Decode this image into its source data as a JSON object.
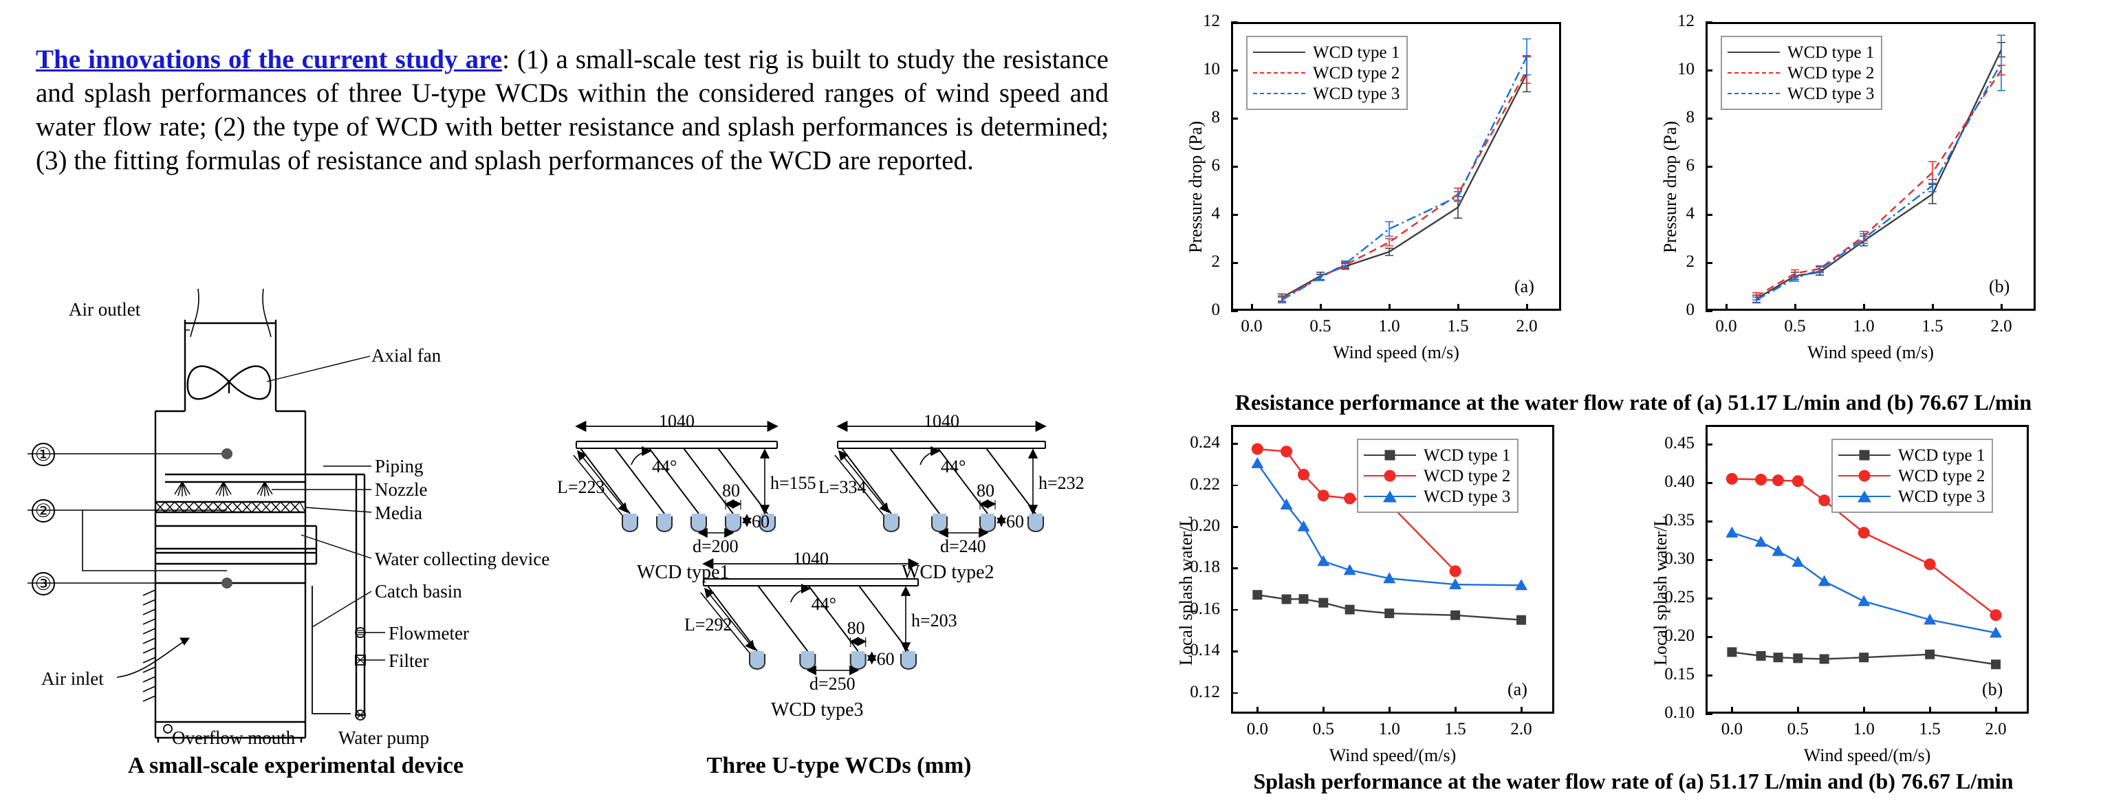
{
  "intro": {
    "lead": "The innovations of the current study are",
    "body": ": (1) a small-scale test rig is built to study the resistance and splash performances of three U-type WCDs within the considered ranges of wind speed and water flow rate; (2) the type of WCD with better resistance and splash performances is determined; (3) the fitting formulas of resistance and splash performances of the WCD are reported.",
    "lead_color": "#1919d0"
  },
  "captions": {
    "device": "A small-scale experimental device",
    "wcds": "Three U-type WCDs (mm)",
    "resistance": "Resistance performance  at the water flow rate of (a) 51.17 L/min and (b) 76.67 L/min",
    "splash": "Splash performance  at the water flow rate of (a) 51.17 L/min and (b) 76.67 L/min"
  },
  "device_diagram": {
    "labels": {
      "air_outlet": "Air outlet",
      "axial_fan": "Axial fan",
      "piping": "Piping",
      "nozzle": "Nozzle",
      "media": "Media",
      "water_collecting_device": "Water collecting device",
      "catch_basin": "Catch basin",
      "flowmeter": "Flowmeter",
      "filter": "Filter",
      "air_inlet": "Air inlet",
      "overflow_mouth": "Overflow mouth",
      "water_pump": "Water pump"
    },
    "callouts": [
      "①",
      "②",
      "③"
    ]
  },
  "wcds": [
    {
      "name": "WCD type1",
      "span": "1040",
      "L": "L=223",
      "angle": "44°",
      "width80": "80",
      "depth60": "60",
      "h": "h=155",
      "d": "d=200",
      "cups": 5
    },
    {
      "name": "WCD type2",
      "span": "1040",
      "L": "L=334",
      "angle": "44°",
      "width80": "80",
      "depth60": "60",
      "h": "h=232",
      "d": "d=240",
      "cups": 4
    },
    {
      "name": "WCD type3",
      "span": "1040",
      "L": "L=292",
      "angle": "44°",
      "width80": "80",
      "depth60": "60",
      "h": "h=203",
      "d": "d=250",
      "cups": 4
    }
  ],
  "colors": {
    "type1": "#3f3f3f",
    "type2": "#ef2a24",
    "type3": "#1a6fe0"
  },
  "chart_data": [
    {
      "id": "resistance-a",
      "type": "line",
      "title": "",
      "panel_tag": "(a)",
      "xlabel": "Wind speed (m/s)",
      "ylabel": "Pressure drop (Pa)",
      "xlim": [
        -0.15,
        2.25
      ],
      "ylim": [
        0,
        12
      ],
      "xticks": [
        0.0,
        0.5,
        1.0,
        1.5,
        2.0
      ],
      "xticklabels": [
        "0.0",
        "0.5",
        "1.0",
        "1.5",
        "2.0"
      ],
      "yticks": [
        0,
        2,
        4,
        6,
        8,
        10,
        12
      ],
      "yticklabels": [
        "0",
        "2",
        "4",
        "6",
        "8",
        "10",
        "12"
      ],
      "grid": false,
      "legend_position": "top-left",
      "x": [
        0.22,
        0.5,
        0.68,
        1.0,
        1.5,
        2.0
      ],
      "series": [
        {
          "name": "WCD type 1",
          "style": "solid",
          "color": "#3f3f3f",
          "values": [
            0.55,
            1.45,
            1.85,
            2.45,
            4.3,
            9.85
          ],
          "err": [
            0.15,
            0.15,
            0.12,
            0.15,
            0.45,
            0.75
          ]
        },
        {
          "name": "WCD type 2",
          "style": "dashed",
          "color": "#ef2a24",
          "values": [
            0.5,
            1.4,
            1.9,
            2.85,
            4.85,
            10.0
          ],
          "err": [
            0.12,
            0.12,
            0.12,
            0.15,
            0.25,
            0.55
          ]
        },
        {
          "name": "WCD type 3",
          "style": "dashdot",
          "color": "#1a6fe0",
          "values": [
            0.45,
            1.38,
            1.95,
            3.4,
            4.75,
            10.55
          ],
          "err": [
            0.12,
            0.12,
            0.12,
            0.3,
            0.2,
            0.75
          ]
        }
      ]
    },
    {
      "id": "resistance-b",
      "type": "line",
      "title": "",
      "panel_tag": "(b)",
      "xlabel": "Wind speed (m/s)",
      "ylabel": "Pressure drop (Pa)",
      "xlim": [
        -0.15,
        2.25
      ],
      "ylim": [
        0,
        12
      ],
      "xticks": [
        0.0,
        0.5,
        1.0,
        1.5,
        2.0
      ],
      "xticklabels": [
        "0.0",
        "0.5",
        "1.0",
        "1.5",
        "2.0"
      ],
      "yticks": [
        0,
        2,
        4,
        6,
        8,
        10,
        12
      ],
      "yticklabels": [
        "0",
        "2",
        "4",
        "6",
        "8",
        "10",
        "12"
      ],
      "grid": false,
      "legend_position": "top-left",
      "x": [
        0.22,
        0.5,
        0.68,
        1.0,
        1.5,
        2.0
      ],
      "series": [
        {
          "name": "WCD type 1",
          "style": "solid",
          "color": "#3f3f3f",
          "values": [
            0.5,
            1.45,
            1.6,
            2.9,
            4.85,
            10.85
          ],
          "err": [
            0.15,
            0.15,
            0.12,
            0.2,
            0.4,
            0.3
          ]
        },
        {
          "name": "WCD type 2",
          "style": "dashed",
          "color": "#ef2a24",
          "values": [
            0.6,
            1.55,
            1.75,
            3.1,
            5.75,
            10.0
          ],
          "err": [
            0.15,
            0.15,
            0.12,
            0.2,
            0.45,
            0.2
          ]
        },
        {
          "name": "WCD type 3",
          "style": "dashdot",
          "color": "#1a6fe0",
          "values": [
            0.45,
            1.35,
            1.7,
            3.0,
            5.2,
            10.3
          ],
          "err": [
            0.12,
            0.12,
            0.12,
            0.2,
            0.25,
            1.15
          ]
        }
      ]
    },
    {
      "id": "splash-a",
      "type": "line",
      "title": "",
      "panel_tag": "(a)",
      "xlabel": "Wind speed/(m/s)",
      "ylabel": "Local splash water/L",
      "xlim": [
        -0.2,
        2.25
      ],
      "ylim": [
        0.11,
        0.249
      ],
      "xticks": [
        0.0,
        0.5,
        1.0,
        1.5,
        2.0
      ],
      "xticklabels": [
        "0.0",
        "0.5",
        "1.0",
        "1.5",
        "2.0"
      ],
      "yticks": [
        0.12,
        0.14,
        0.16,
        0.18,
        0.2,
        0.22,
        0.24
      ],
      "yticklabels": [
        "0.12",
        "0.14",
        "0.16",
        "0.18",
        "0.20",
        "0.22",
        "0.24"
      ],
      "grid": false,
      "legend_position": "top-right",
      "x": [
        0.0,
        0.22,
        0.35,
        0.5,
        0.7,
        1.0,
        1.5,
        2.0
      ],
      "series": [
        {
          "name": "WCD type 1",
          "marker": "square",
          "color": "#3f3f3f",
          "values": [
            0.1672,
            0.1651,
            0.1652,
            0.1634,
            0.1601,
            0.1583,
            0.1574,
            0.1551
          ]
        },
        {
          "name": "WCD type 2",
          "marker": "circle",
          "color": "#ef2a24",
          "values": [
            0.2374,
            0.2362,
            0.2251,
            0.215,
            0.2136,
            0.211,
            0.1786,
            null
          ]
        },
        {
          "name": "WCD type 3",
          "marker": "triangle",
          "color": "#1a6fe0",
          "values": [
            0.2305,
            0.2106,
            0.2001,
            0.1834,
            0.1791,
            0.1751,
            0.1722,
            0.1718
          ]
        }
      ]
    },
    {
      "id": "splash-b",
      "type": "line",
      "title": "",
      "panel_tag": "(b)",
      "xlabel": "Wind speed/(m/s)",
      "ylabel": "Local splash water/L",
      "xlim": [
        -0.2,
        2.25
      ],
      "ylim": [
        0.1,
        0.475
      ],
      "xticks": [
        0.0,
        0.5,
        1.0,
        1.5,
        2.0
      ],
      "xticklabels": [
        "0.0",
        "0.5",
        "1.0",
        "1.5",
        "2.0"
      ],
      "yticks": [
        0.1,
        0.15,
        0.2,
        0.25,
        0.3,
        0.35,
        0.4,
        0.45
      ],
      "yticklabels": [
        "0.10",
        "0.15",
        "0.20",
        "0.25",
        "0.30",
        "0.35",
        "0.40",
        "0.45"
      ],
      "grid": false,
      "legend_position": "top-right",
      "x": [
        0.0,
        0.22,
        0.35,
        0.5,
        0.7,
        1.0,
        1.5,
        2.0
      ],
      "series": [
        {
          "name": "WCD type 1",
          "marker": "square",
          "color": "#3f3f3f",
          "values": [
            0.18,
            0.175,
            0.173,
            0.172,
            0.171,
            0.173,
            0.177,
            0.164
          ]
        },
        {
          "name": "WCD type 2",
          "marker": "circle",
          "color": "#ef2a24",
          "values": [
            0.405,
            0.404,
            0.403,
            0.402,
            0.377,
            0.335,
            0.294,
            0.228
          ]
        },
        {
          "name": "WCD type 3",
          "marker": "triangle",
          "color": "#1a6fe0",
          "values": [
            0.335,
            0.323,
            0.311,
            0.297,
            0.272,
            0.246,
            0.222,
            0.205
          ]
        }
      ]
    }
  ]
}
